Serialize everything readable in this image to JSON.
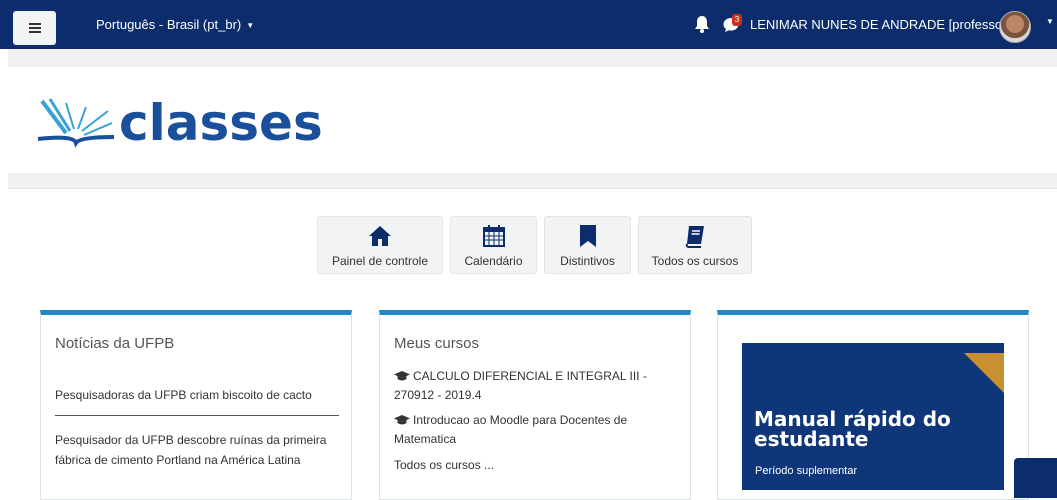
{
  "topbar": {
    "menu_icon": "hamburger-icon",
    "language": "Português - Brasil (pt_br)",
    "notifications_icon": "bell-icon",
    "messages_icon": "chat-icon",
    "messages_badge": "3",
    "user_name": "LENIMAR NUNES DE ANDRADE [professor]",
    "bar_color": "#0d2c6b"
  },
  "logo": {
    "text": "classes",
    "color": "#1a4f9c"
  },
  "quick_links": [
    {
      "label": "Painel de controle",
      "icon": "home-icon"
    },
    {
      "label": "Calendário",
      "icon": "calendar-icon"
    },
    {
      "label": "Distintivos",
      "icon": "bookmark-icon"
    },
    {
      "label": "Todos os cursos",
      "icon": "book-icon"
    }
  ],
  "news": {
    "title": "Notícias da UFPB",
    "items": [
      "Pesquisadoras da UFPB criam biscoito de cacto",
      "Pesquisador da UFPB descobre ruínas da primeira fábrica de cimento Portland na América Latina"
    ]
  },
  "courses": {
    "title": "Meus cursos",
    "items": [
      "CALCULO DIFERENCIAL E INTEGRAL III - 270912 - 2019.4",
      "Introducao ao Moodle para Docentes de Matematica"
    ],
    "all_link": "Todos os cursos ..."
  },
  "banner": {
    "title": "Manual rápido do estudante",
    "subtitle": "Período suplementar",
    "background": "#0f3678",
    "accent": "#c8902e"
  },
  "accent_color": "#1e88c7"
}
